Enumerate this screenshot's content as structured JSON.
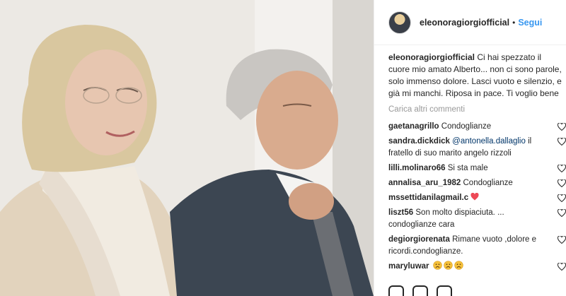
{
  "post": {
    "username": "eleonoragiorgiofficial",
    "separator": "•",
    "follow_label": "Segui",
    "caption_text": "Ci hai spezzato il cuore mio amato Alberto... non ci sono parole, solo immenso dolore. Lasci vuoto e silenzio, e già mi manchi. Riposa in pace. Ti voglio bene"
  },
  "load_more_label": "Carica altri commenti",
  "comments": [
    {
      "user": "gaetanagrillo",
      "text": "Condoglianze"
    },
    {
      "user": "sandra.dickdick",
      "mention": "@antonella.dallaglio",
      "text": "il fratello di suo marito angelo rizzoli"
    },
    {
      "user": "lilli.molinaro66",
      "text": "Si sta male"
    },
    {
      "user": "annalisa_aru_1982",
      "text": "Condoglianze"
    },
    {
      "user": "mssettidanilagmail.c",
      "emoji": "red-heart"
    },
    {
      "user": "liszt56",
      "text": "Son molto dispiaciuta. ... condoglianze cara"
    },
    {
      "user": "degiorgiorenata",
      "text": "Rimane vuoto ,dolore e ricordi.condoglianze."
    },
    {
      "user": "maryluwar",
      "emoji": "sad-face x3"
    }
  ],
  "icons": [
    "like-heart-icon",
    "red-heart-emoji",
    "sad-face-emoji"
  ],
  "colors": {
    "link": "#3897f0",
    "text": "#262626",
    "muted": "#999999",
    "heart": "#ed4956"
  }
}
